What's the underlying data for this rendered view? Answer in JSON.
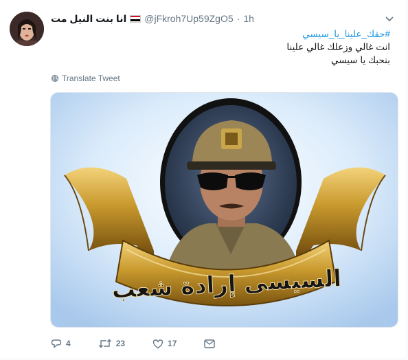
{
  "tweet": {
    "display_name": "انا بنت النيل مت",
    "handle": "@jFkroh7Up59ZgO5",
    "separator": "·",
    "time": "1h",
    "hashtag": "#حقك_علينا_يا_سيسي",
    "lines": [
      "انت غالي وزعلك غالي علينا",
      "بنحبك يا سيسي"
    ],
    "translate_label": "Translate Tweet",
    "image_banner_text": "السيسى إرادة شعب"
  },
  "actions": {
    "reply_count": "4",
    "retweet_count": "23",
    "like_count": "17"
  },
  "colors": {
    "link": "#1b95e0",
    "secondary_text": "#657786",
    "banner_gold": "#c99a2e",
    "flag_red": "#ce1126",
    "flag_black": "#000000"
  },
  "icons": [
    "caret-down-icon",
    "globe-icon",
    "reply-icon",
    "retweet-icon",
    "like-icon",
    "dm-icon",
    "egypt-flag-icon"
  ]
}
